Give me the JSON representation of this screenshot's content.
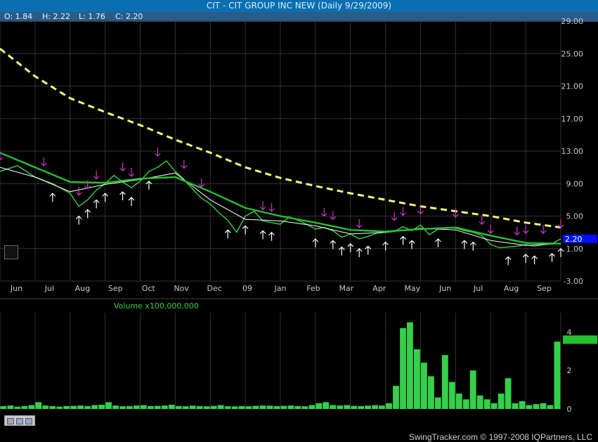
{
  "header": {
    "title": "CIT - CIT GROUP INC NEW (Daily 9/29/2009)",
    "open_label": "O: 1.84",
    "high_label": "H: 2.22",
    "low_label": "L: 1.76",
    "close_label": "C: 2.20"
  },
  "footer": {
    "copyright": "SwingTracker.com © 1997-2008 IQPartners, LLC"
  },
  "colors": {
    "price": "#35d04a",
    "ma_fast": "#ffffff",
    "ma_slow": "#24c030",
    "ma_long": "#f7f37a",
    "sell_arrow": "#cc33cc",
    "buy_arrow": "#ffffff",
    "grid": "#333333",
    "last_price_tag": "#0010ff"
  },
  "chart_data": [
    {
      "type": "line",
      "title": "CIT - CIT GROUP INC NEW (Daily 9/29/2009)",
      "x_labels": [
        "Jun",
        "Jul",
        "Aug",
        "Sep",
        "Oct",
        "Nov",
        "Dec",
        "09",
        "Jan",
        "Feb",
        "Mar",
        "Apr",
        "May",
        "Jun",
        "Jul",
        "Aug",
        "Sep"
      ],
      "y_ticks": [
        29.0,
        25.0,
        21.0,
        17.0,
        13.0,
        9.0,
        5.0,
        1.0,
        -3.0
      ],
      "y_tick_labels": [
        "29.00",
        "25.00",
        "21.00",
        "17.00",
        "13.00",
        "9.00",
        "5.00",
        "1.00",
        "-3.00"
      ],
      "ylim": [
        -3,
        29
      ],
      "grid": true,
      "last_price": 2.2,
      "last_price_label": "2.20",
      "series": [
        {
          "role": "price",
          "points": [
            [
              0,
              10.5
            ],
            [
              2,
              11.2
            ],
            [
              4,
              9.8
            ],
            [
              6,
              9.0
            ],
            [
              8,
              7.8
            ],
            [
              9,
              6.2
            ],
            [
              10,
              7.0
            ],
            [
              11,
              8.2
            ],
            [
              12,
              9.0
            ],
            [
              13,
              10.0
            ],
            [
              14,
              9.2
            ],
            [
              15,
              8.5
            ],
            [
              16,
              9.3
            ],
            [
              17,
              10.5
            ],
            [
              18,
              11.0
            ],
            [
              19,
              11.8
            ],
            [
              20,
              10.5
            ],
            [
              21,
              9.5
            ],
            [
              22,
              8.3
            ],
            [
              23,
              7.2
            ],
            [
              24,
              6.5
            ],
            [
              25,
              5.4
            ],
            [
              26,
              4.5
            ],
            [
              27,
              3.0
            ],
            [
              28,
              5.0
            ],
            [
              29,
              5.6
            ],
            [
              30,
              4.4
            ],
            [
              31,
              4.2
            ],
            [
              32,
              4.0
            ],
            [
              33,
              4.9
            ],
            [
              34,
              4.5
            ],
            [
              35,
              4.0
            ],
            [
              36,
              3.4
            ],
            [
              37,
              3.6
            ],
            [
              38,
              3.2
            ],
            [
              39,
              2.4
            ],
            [
              40,
              2.8
            ],
            [
              41,
              2.2
            ],
            [
              42,
              2.5
            ],
            [
              43,
              2.9
            ],
            [
              44,
              3.0
            ],
            [
              45,
              3.1
            ],
            [
              46,
              3.7
            ],
            [
              47,
              3.2
            ],
            [
              48,
              3.9
            ],
            [
              49,
              2.7
            ],
            [
              50,
              3.4
            ],
            [
              51,
              3.6
            ],
            [
              52,
              3.5
            ],
            [
              53,
              3.2
            ],
            [
              54,
              3.0
            ],
            [
              55,
              2.6
            ],
            [
              56,
              1.5
            ],
            [
              57,
              1.1
            ],
            [
              58,
              1.2
            ],
            [
              59,
              1.3
            ],
            [
              60,
              1.5
            ],
            [
              61,
              1.3
            ],
            [
              62,
              1.5
            ],
            [
              63,
              1.6
            ],
            [
              64,
              2.2
            ]
          ]
        },
        {
          "role": "ma_fast",
          "points": [
            [
              0,
              11.0
            ],
            [
              4,
              9.8
            ],
            [
              8,
              8.0
            ],
            [
              12,
              8.9
            ],
            [
              16,
              9.5
            ],
            [
              20,
              10.3
            ],
            [
              24,
              7.0
            ],
            [
              28,
              4.6
            ],
            [
              32,
              4.4
            ],
            [
              36,
              3.8
            ],
            [
              40,
              2.8
            ],
            [
              44,
              3.0
            ],
            [
              48,
              3.5
            ],
            [
              52,
              3.3
            ],
            [
              56,
              2.0
            ],
            [
              60,
              1.4
            ],
            [
              64,
              1.6
            ]
          ]
        },
        {
          "role": "ma_slow",
          "points": [
            [
              0,
              12.8
            ],
            [
              4,
              11.0
            ],
            [
              8,
              9.2
            ],
            [
              12,
              9.1
            ],
            [
              16,
              9.6
            ],
            [
              20,
              9.8
            ],
            [
              24,
              8.0
            ],
            [
              28,
              6.0
            ],
            [
              32,
              5.0
            ],
            [
              36,
              4.2
            ],
            [
              40,
              3.3
            ],
            [
              44,
              3.1
            ],
            [
              48,
              3.4
            ],
            [
              52,
              3.6
            ],
            [
              56,
              2.6
            ],
            [
              60,
              1.7
            ],
            [
              64,
              1.6
            ]
          ]
        },
        {
          "role": "ma_long",
          "points": [
            [
              0,
              25.6
            ],
            [
              4,
              22.2
            ],
            [
              8,
              19.5
            ],
            [
              12,
              17.8
            ],
            [
              16,
              16.2
            ],
            [
              20,
              14.4
            ],
            [
              24,
              12.8
            ],
            [
              28,
              11.0
            ],
            [
              32,
              9.7
            ],
            [
              36,
              8.7
            ],
            [
              40,
              7.8
            ],
            [
              44,
              7.0
            ],
            [
              48,
              6.2
            ],
            [
              52,
              5.6
            ],
            [
              56,
              5.0
            ],
            [
              60,
              4.2
            ],
            [
              64,
              3.6
            ]
          ]
        }
      ],
      "sell_signals": [
        0,
        5,
        9,
        10,
        11,
        14,
        15,
        18,
        21,
        23,
        30,
        31,
        37,
        38,
        41,
        45,
        46,
        48,
        52,
        55,
        56,
        59,
        60,
        62,
        64
      ],
      "buy_signals": [
        6,
        9,
        10,
        11,
        12,
        14,
        15,
        17,
        26,
        28,
        30,
        31,
        36,
        38,
        39,
        40,
        41,
        42,
        44,
        46,
        47,
        50,
        53,
        54,
        58,
        60,
        61,
        63,
        64
      ]
    },
    {
      "type": "bar",
      "title": "Volume x100,000,000",
      "y_ticks": [
        0,
        2,
        4
      ],
      "y_tick_labels": [
        "0",
        "2",
        "4"
      ],
      "ylim": [
        0,
        5
      ],
      "last_value": 3.6,
      "values": [
        0.15,
        0.18,
        0.12,
        0.15,
        0.2,
        0.35,
        0.18,
        0.15,
        0.12,
        0.15,
        0.16,
        0.18,
        0.15,
        0.2,
        0.22,
        0.35,
        0.18,
        0.14,
        0.15,
        0.18,
        0.2,
        0.15,
        0.16,
        0.18,
        0.22,
        0.15,
        0.14,
        0.17,
        0.15,
        0.14,
        0.16,
        0.2,
        0.14,
        0.13,
        0.15,
        0.14,
        0.16,
        0.18,
        0.17,
        0.15,
        0.16,
        0.18,
        0.15,
        0.14,
        0.2,
        0.3,
        0.35,
        0.2,
        0.18,
        0.2,
        0.16,
        0.15,
        0.17,
        0.2,
        0.18,
        0.3,
        1.2,
        4.2,
        4.5,
        3.1,
        2.4,
        1.7,
        0.6,
        2.8,
        1.4,
        0.8,
        0.5,
        2.0,
        0.7,
        0.5,
        0.3,
        0.8,
        1.6,
        0.3,
        0.4,
        0.2,
        0.25,
        0.3,
        0.2,
        3.5
      ]
    }
  ]
}
